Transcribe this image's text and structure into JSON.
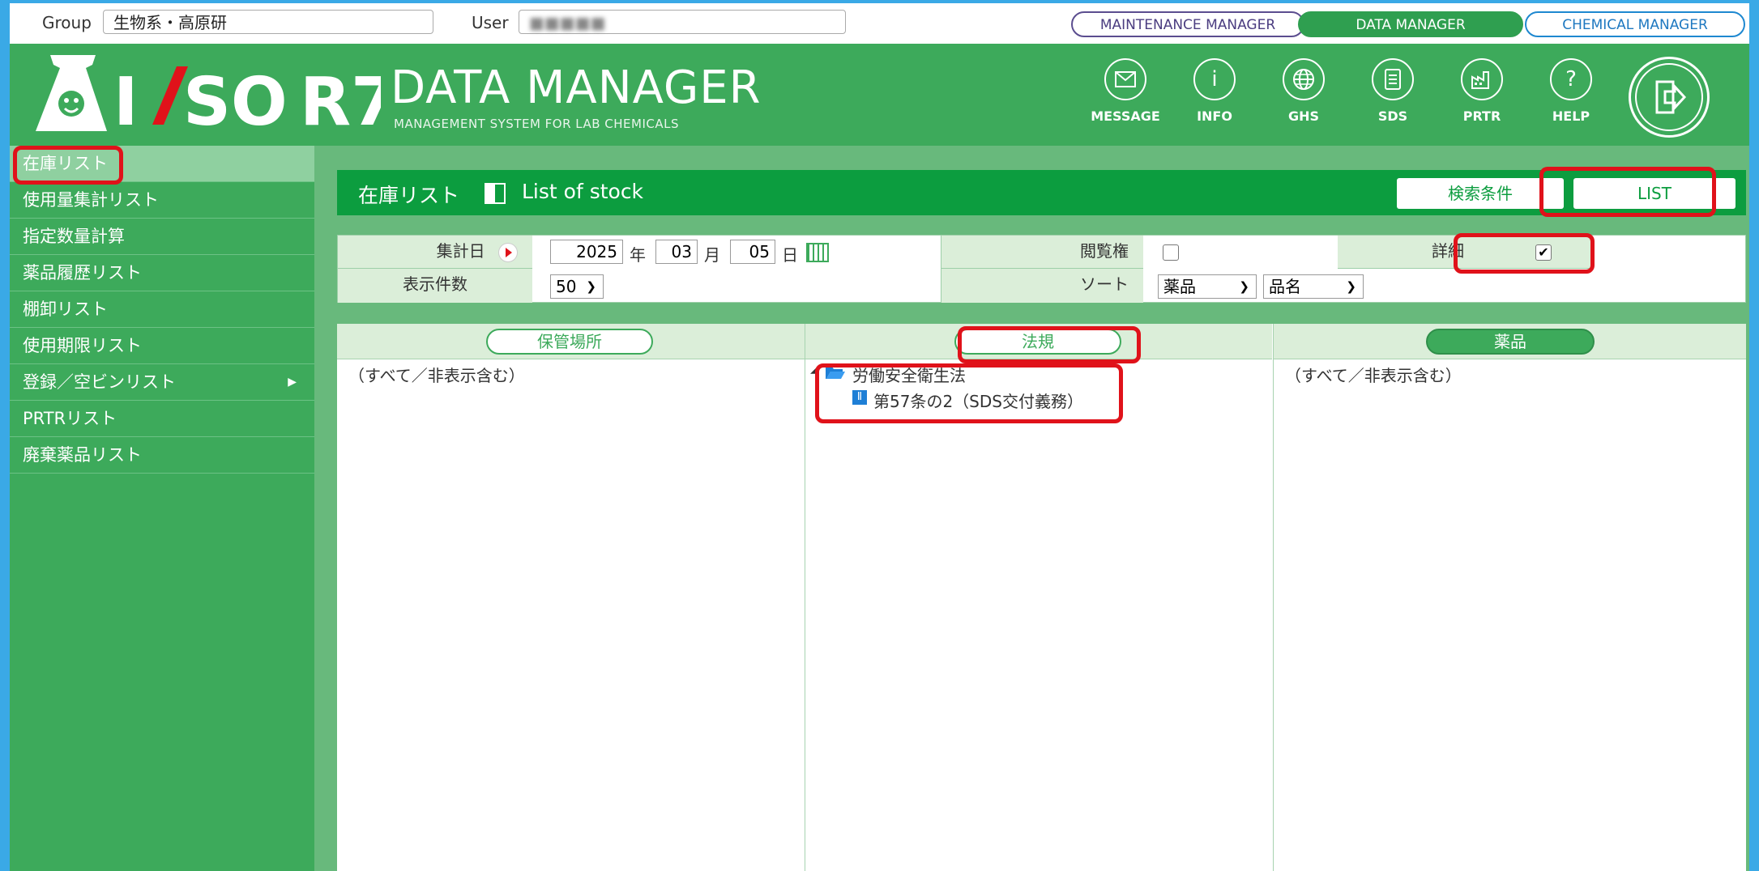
{
  "topbar": {
    "group_label": "Group",
    "group_value": "生物系・高原研",
    "user_label": "User",
    "user_value": "■■■■■",
    "managers": [
      "MAINTENANCE MANAGER",
      "DATA MANAGER",
      "CHEMICAL MANAGER"
    ],
    "active_manager": "DATA MANAGER"
  },
  "header": {
    "logo_text": "IASO R7",
    "title": "DATA MANAGER",
    "subtitle": "MANAGEMENT SYSTEM FOR LAB CHEMICALS",
    "icons": [
      {
        "label": "MESSAGE",
        "icon": "envelope-icon"
      },
      {
        "label": "INFO",
        "icon": "info-icon"
      },
      {
        "label": "GHS",
        "icon": "globe-icon"
      },
      {
        "label": "SDS",
        "icon": "document-icon"
      },
      {
        "label": "PRTR",
        "icon": "factory-icon"
      },
      {
        "label": "HELP",
        "icon": "question-icon"
      }
    ],
    "logout_icon": "logout-door-icon"
  },
  "sidebar": {
    "items": [
      {
        "label": "在庫リスト"
      },
      {
        "label": "使用量集計リスト"
      },
      {
        "label": "指定数量計算"
      },
      {
        "label": "薬品履歴リスト"
      },
      {
        "label": "棚卸リスト"
      },
      {
        "label": "使用期限リスト"
      },
      {
        "label": "登録／空ビンリスト"
      },
      {
        "label": "PRTRリスト"
      },
      {
        "label": "廃棄薬品リスト"
      }
    ],
    "active_index": 0
  },
  "main": {
    "title_jp": "在庫リスト",
    "title_en": "List of stock",
    "search_button": "検索条件",
    "list_button": "LIST",
    "form": {
      "date_label": "集計日",
      "year": "2025",
      "year_unit": "年",
      "month": "03",
      "month_unit": "月",
      "day": "05",
      "day_unit": "日",
      "view_label": "閲覧権",
      "view_checked": false,
      "detail_label": "詳細",
      "detail_checked": true,
      "count_label": "表示件数",
      "count_value": "50",
      "sort_label": "ソート",
      "sort1": "薬品",
      "sort2": "品名"
    },
    "panels": {
      "storage_button": "保管場所",
      "storage_text": "（すべて／非表示含む）",
      "law_button": "法規",
      "law_tree_root": "労働安全衛生法",
      "law_tree_child": "第57条の2（SDS交付義務）",
      "chem_button": "薬品",
      "chem_text": "（すべて／非表示含む）"
    }
  }
}
